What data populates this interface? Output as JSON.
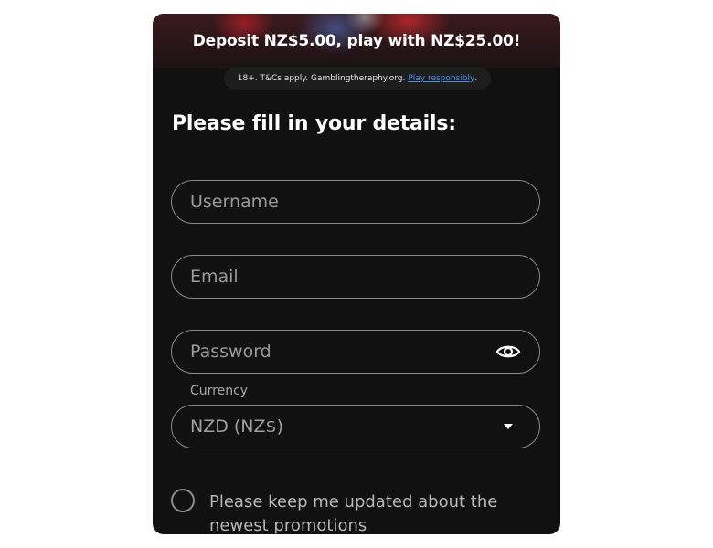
{
  "banner": {
    "title": "Deposit NZ$5.00, play with NZ$25.00!"
  },
  "terms": {
    "text": "18+. T&Cs apply. Gamblingtheraphy.org.",
    "link_text": "Play responsibly",
    "suffix": "."
  },
  "form": {
    "heading": "Please fill in your details:",
    "username": {
      "placeholder": "Username",
      "value": ""
    },
    "email": {
      "placeholder": "Email",
      "value": ""
    },
    "password": {
      "placeholder": "Password",
      "value": "",
      "toggle_icon": "eye-icon"
    },
    "currency": {
      "label": "Currency",
      "selected": "NZD (NZ$)",
      "dropdown_icon": "caret-down-icon"
    },
    "promotions": {
      "label": "Please keep me updated about the newest promotions",
      "checked": false
    }
  },
  "colors": {
    "background": "#111111",
    "text": "#ffffff",
    "border": "#8a8a8a",
    "link": "#4d8fe8"
  }
}
